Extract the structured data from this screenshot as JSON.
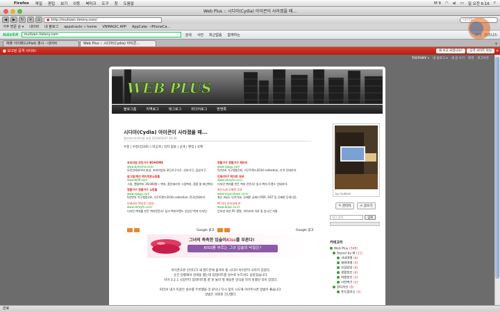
{
  "menubar": {
    "app": "Firefox",
    "items": [
      "파일",
      "편집",
      "보기",
      "이동",
      "북마크",
      "도구",
      "창",
      "도움말"
    ],
    "right_text": "M 9",
    "clock": "일 오전 6:16"
  },
  "window": {
    "title": "Web Plus :: 시디아(Cydia) 아이콘이 사라졌을 때..."
  },
  "nav": {
    "url": "http://mutizen.tistory.com/",
    "search_placeholder": "네이버"
  },
  "bookmarks": {
    "items": [
      "가주 방문 순 ▾",
      "네이버",
      "네 블로그",
      "appstrackr » home",
      "VNMAGIC APP",
      "AppCake - iPhoneCa..."
    ]
  },
  "naver": {
    "logo": "NAVER",
    "input": "mutizen.tistory.com",
    "buttons": [
      "검색",
      "사전",
      "최근없음",
      "함께하는"
    ],
    "right_items": [
      "관리",
      "비즈니스"
    ]
  },
  "tabs": [
    {
      "label": "애플 아이패드(iPad) 출시 - 네이버"
    },
    {
      "label": "Web Plus :: 시디아(Cydia) 아이콘..."
    }
  ],
  "notif": {
    "label": "보고된 공격 사이트!",
    "buttons": [
      "왜 보고 되었나요?",
      "공격 사이트 아님"
    ]
  },
  "tistory": {
    "items": [
      "TISTORY ▾",
      "내 블로그 ▾",
      "새 글 쓰기",
      "환경",
      "로그아웃"
    ]
  },
  "blog": {
    "header_title": "WEB PLUS",
    "menu": [
      "블로그홈",
      "지역로그",
      "태그로그",
      "미디어로그",
      "방명록"
    ]
  },
  "post": {
    "title": "시디아(Cydia) 아이콘이 사라졌을 때...",
    "meta": "멀티미디어/아이폰 포럼   2010/02/07 20:40",
    "actions": "수정 | 수정(임의로) | 비공개 | 의자 없을 | 공개 | 편집 | 삭제",
    "ads_left": [
      {
        "title": "프리미엄 모던가구 BOHOME",
        "url": "www.bohome.co.kr",
        "desc": "모던인테리어의 완성, 프리미엄의 모던가구가구, 선호가구, 감성가구."
      },
      {
        "title": "원그림/벽지 벽지전문쇼핑몰",
        "url": "www.bj09.com",
        "desc": "그림, 캔들벽지 19,000원~ 벽지, 홈인테리어 그림벽지, 정품 필 최신벽지."
      },
      {
        "title": "명품가구 명품가구 쇼핑몰",
        "url": "www.rgagu.com",
        "desc": "5년연속 가구랭킹1위, 가구트렌드2010 collection, 전국인테리어."
      },
      {
        "title": "인테리어 벽지로 디자인",
        "url": "www.semyhi.co.kr",
        "desc": "디자인 벽지를 만든 벽지전문사! 실크 벽지브랜드 신상인 벽지 디자인."
      }
    ],
    "ads_right": [
      {
        "title": "명품가구 명품가구 체리쉬",
        "url": "www.rgagu.com",
        "desc": "5년연속 가구랭킹1위, 가구트렌드2010 collection, 가격 인테리어."
      },
      {
        "title": "인테리어? 벽지로 대세",
        "url": "www.semyhi.co.kr",
        "desc": "디자인 벽지를 만든 벽지 전문사! 실크 벽지 트렌드 인테리어."
      },
      {
        "title": "최신노래 무제한 무료",
        "url": "www.musicdown.co.kr",
        "desc": "최신 mp3, 인기가요, 무제한 공짜기 PDF, OST 등 무제한 무료다운."
      },
      {
        "title": "PC이다 인터넷에 번",
        "url": "www.bizpc.co.kr",
        "desc": "인터넷 회선 PC 렌탈, 하이러피 치료 및 실시간 지원."
      }
    ],
    "google_ad_label": "Google 광고",
    "banner_text1": "그녀의 촉촉한 입술이",
    "banner_brand": "Kiss",
    "banner_text2": "를 부른다!",
    "banner_sub": "KISS를 부르는 그녀 입술의 비밀은?",
    "body": [
      "아이폰초본 인터디가 새 핸드폰에 옮겨야 할 시디아 아이콘이 사라지 있었다.",
      "순간 당황해서 검색을 했는데 업데이트를 실수로 누르셔도 남았었습니다.",
      "이미 3.2.1 시점부터 업데이트를 잘 못 놀러 질 세팅된 방식을 하지 못했던 작이 있었다.",
      "",
      "따라서 내가 똑같은 실수를 두번했을 것 같으니 다시 찾지 시도해 이어주시면 방법이 좋습니다.",
      "방법은 의외로 간단했다."
    ]
  },
  "sidebar": {
    "photo_caption": "by mutizen",
    "buttons": [
      "관리자",
      "글쓰기"
    ],
    "search_placeholder": "태그 검색",
    "search_button": "검색",
    "categories_title": "카테고리",
    "categories": [
      {
        "label": "Web Plus",
        "count": "(346)"
      },
      {
        "label": "Styled by M",
        "count": "(11)"
      },
      {
        "label": "국내여행",
        "count": "(6)"
      },
      {
        "label": "해외여행",
        "count": "(5)"
      },
      {
        "label": "맛집탐방",
        "count": "(4)"
      },
      {
        "label": "생활정보",
        "count": "(4)"
      },
      {
        "label": "여행정보",
        "count": "(3)"
      },
      {
        "label": "사진찍기",
        "count": "(2)"
      },
      {
        "label": "원디자인",
        "count": "(9)"
      },
      {
        "label": "포트폴리오",
        "count": "(3)"
      }
    ]
  },
  "status": {
    "text": "완료"
  }
}
